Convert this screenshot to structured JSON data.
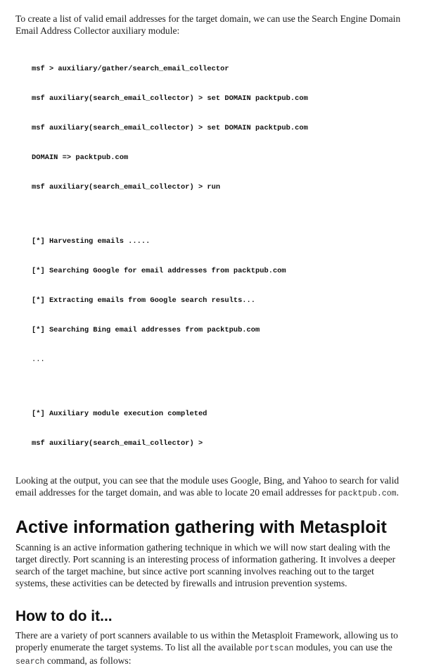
{
  "intro": {
    "text": "To create a list of valid email addresses for the target domain, we can use the Search Engine Domain Email Address Collector auxiliary module:"
  },
  "code": {
    "group1": [
      "msf > auxiliary/gather/search_email_collector",
      "msf auxiliary(search_email_collector) > set DOMAIN packtpub.com",
      "msf auxiliary(search_email_collector) > set DOMAIN packtpub.com",
      "DOMAIN => packtpub.com",
      "msf auxiliary(search_email_collector) > run"
    ],
    "group2": [
      "[*] Harvesting emails .....",
      "[*] Searching Google for email addresses from packtpub.com",
      "[*] Extracting emails from Google search results...",
      "[*] Searching Bing email addresses from packtpub.com",
      "..."
    ],
    "group3": [
      "[*] Auxiliary module execution completed",
      "msf auxiliary(search_email_collector) >"
    ]
  },
  "output_para": {
    "text": "Looking at the output, you can see that the module uses Google, Bing, and Yahoo to search for valid email addresses for the target domain, and was able to locate 20 email addresses for ",
    "code": "packtpub.com",
    "end": "."
  },
  "section": {
    "heading": "Active information gathering with Metasploit",
    "text": "Scanning is an active information gathering technique in which we will now start dealing with the target directly. Port scanning is an interesting process of information gathering. It involves a deeper search of the target machine, but since active port scanning involves reaching out to the target systems, these activities can be detected by firewalls and intrusion prevention systems."
  },
  "howto": {
    "heading": "How to do it...",
    "text1": "There are a variety of port scanners available to us within the Metasploit Framework, allowing us to properly enumerate the target systems. To list all the available ",
    "code1": "portscan",
    "text2": " modules, you can use the ",
    "code2": "search",
    "text3": " command, as follows:"
  }
}
